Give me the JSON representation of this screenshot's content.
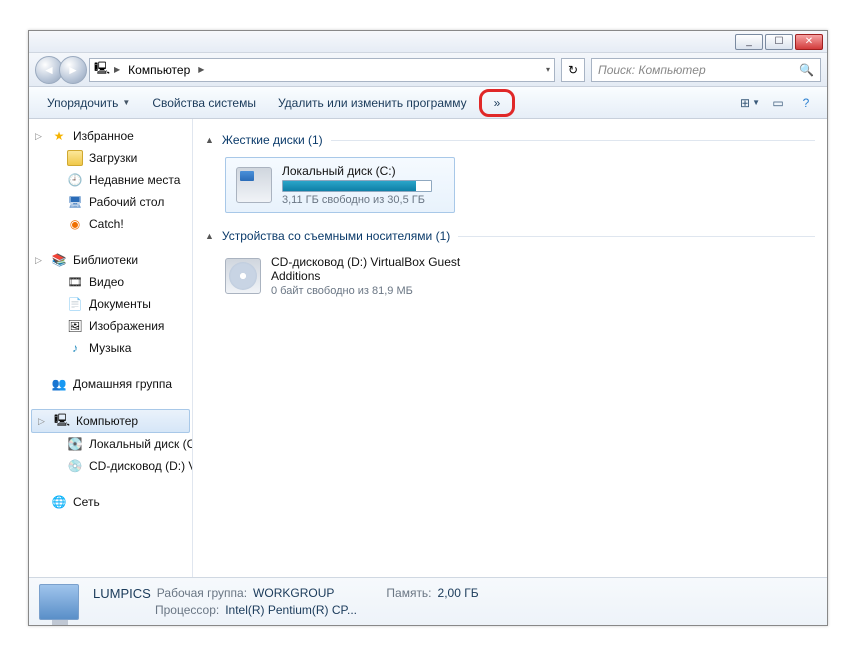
{
  "titlebar": {
    "min": "_",
    "max": "☐",
    "close": "✕"
  },
  "nav": {
    "back": "◄",
    "fwd": "►",
    "crumb_root_icon": "🖳",
    "crumb_label": "Компьютер",
    "refresh_icon": "↻"
  },
  "search": {
    "placeholder": "Поиск: Компьютер",
    "icon": "🔍"
  },
  "toolbar": {
    "organize": "Упорядочить",
    "system_props": "Свойства системы",
    "uninstall": "Удалить или изменить программу",
    "overflow": "»",
    "view_icon": "⊞",
    "preview_icon": "▭",
    "help_icon": "?"
  },
  "sidebar": {
    "favorites": {
      "label": "Избранное",
      "items": [
        "Загрузки",
        "Недавние места",
        "Рабочий стол",
        "Catch!"
      ]
    },
    "libraries": {
      "label": "Библиотеки",
      "items": [
        "Видео",
        "Документы",
        "Изображения",
        "Музыка"
      ]
    },
    "homegroup": {
      "label": "Домашняя группа"
    },
    "computer": {
      "label": "Компьютер",
      "items": [
        "Локальный диск (C",
        "CD-дисковод (D:) Vi"
      ]
    },
    "network": {
      "label": "Сеть"
    }
  },
  "content": {
    "hdd_section": "Жесткие диски (1)",
    "hdd": {
      "name": "Локальный диск (C:)",
      "free": "3,11 ГБ свободно из 30,5 ГБ"
    },
    "removable_section": "Устройства со съемными носителями (1)",
    "cd": {
      "name": "CD-дисковод (D:) VirtualBox Guest Additions",
      "free": "0 байт свободно из 81,9 МБ"
    }
  },
  "status": {
    "name": "LUMPICS",
    "workgroup_lbl": "Рабочая группа:",
    "workgroup_val": "WORKGROUP",
    "mem_lbl": "Память:",
    "mem_val": "2,00 ГБ",
    "cpu_lbl": "Процессор:",
    "cpu_val": "Intel(R) Pentium(R) CP..."
  }
}
